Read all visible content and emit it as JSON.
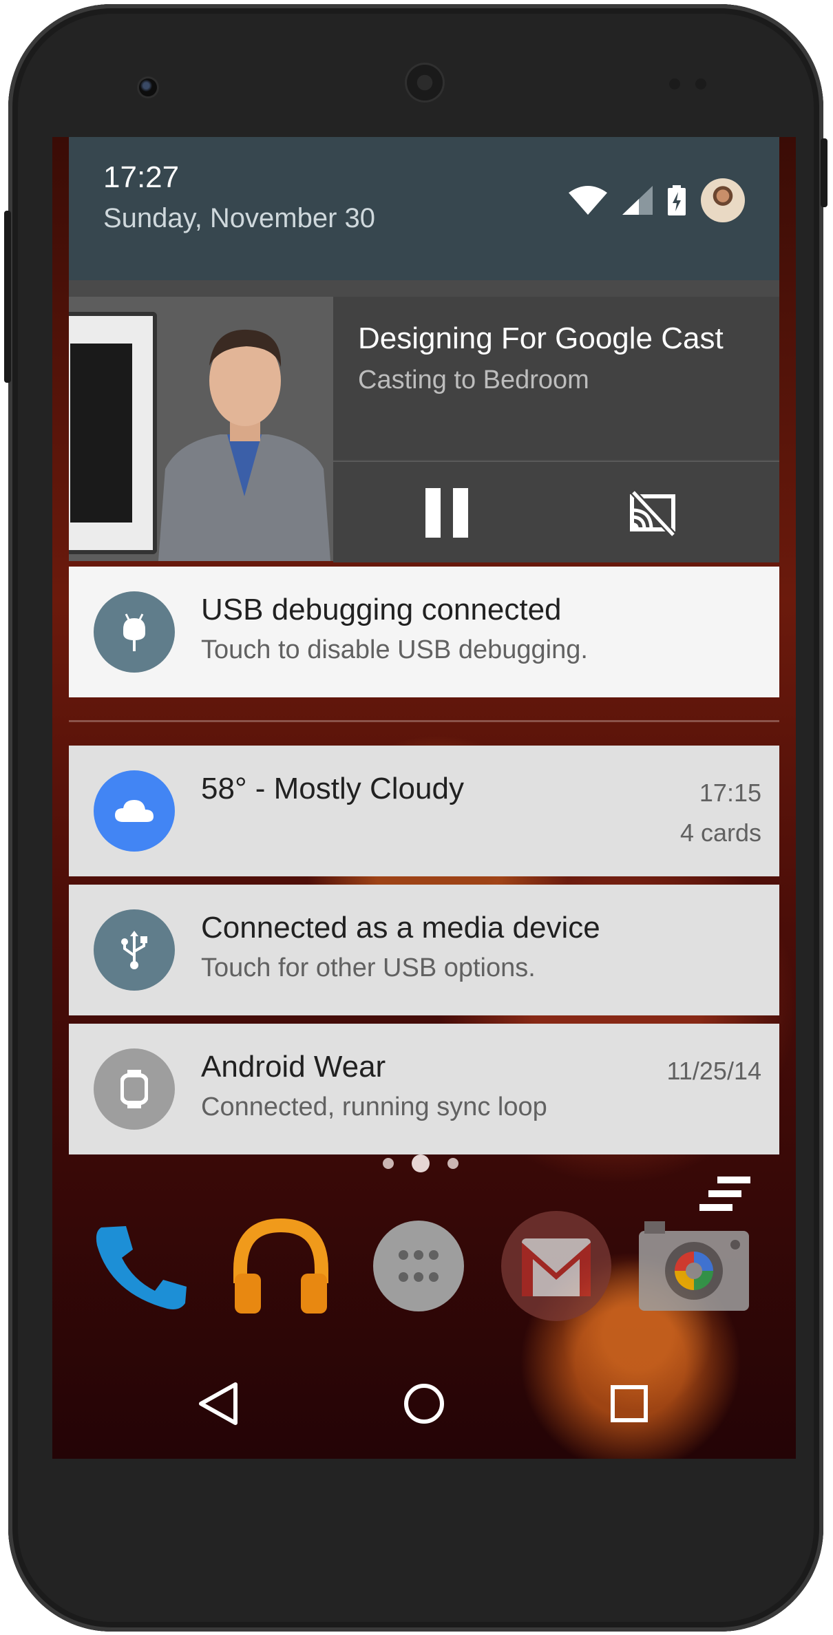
{
  "status_bar": {
    "time": "17:27",
    "date": "Sunday, November 30",
    "icons": [
      "wifi-icon",
      "cell-signal-icon",
      "battery-charging-icon",
      "user-avatar"
    ]
  },
  "media_notification": {
    "title": "Designing For Google Cast",
    "subtitle": "Casting to Bedroom",
    "controls": [
      "pause-icon",
      "stop-cast-icon"
    ]
  },
  "notifications": [
    {
      "title": "USB debugging connected",
      "text": "Touch to disable USB debugging.",
      "icon": "android-debug-icon",
      "icon_color": "#607d8b"
    },
    {
      "title": "58° - Mostly Cloudy",
      "time": "17:15",
      "meta": "4 cards",
      "icon": "cloud-icon",
      "icon_color": "#4285f4"
    },
    {
      "title": "Connected as a media device",
      "text": "Touch for other USB options.",
      "icon": "usb-icon",
      "icon_color": "#607d8b"
    },
    {
      "title": "Android Wear",
      "time": "11/25/14",
      "text": "Connected, running sync loop",
      "icon": "watch-icon",
      "icon_color": "#9e9e9e"
    }
  ],
  "home": {
    "page_indicator": {
      "pages": 3,
      "current": 2
    },
    "dock_apps": [
      "phone-icon",
      "play-music-icon",
      "app-drawer-icon",
      "gmail-icon",
      "camera-icon"
    ],
    "navigation": [
      "back-icon",
      "home-icon",
      "recents-icon"
    ]
  },
  "colors": {
    "header_bg": "#37474f",
    "media_bg": "#424242",
    "card_bg": "#e0e0e0",
    "card_highlight_bg": "#f5f5f5"
  }
}
